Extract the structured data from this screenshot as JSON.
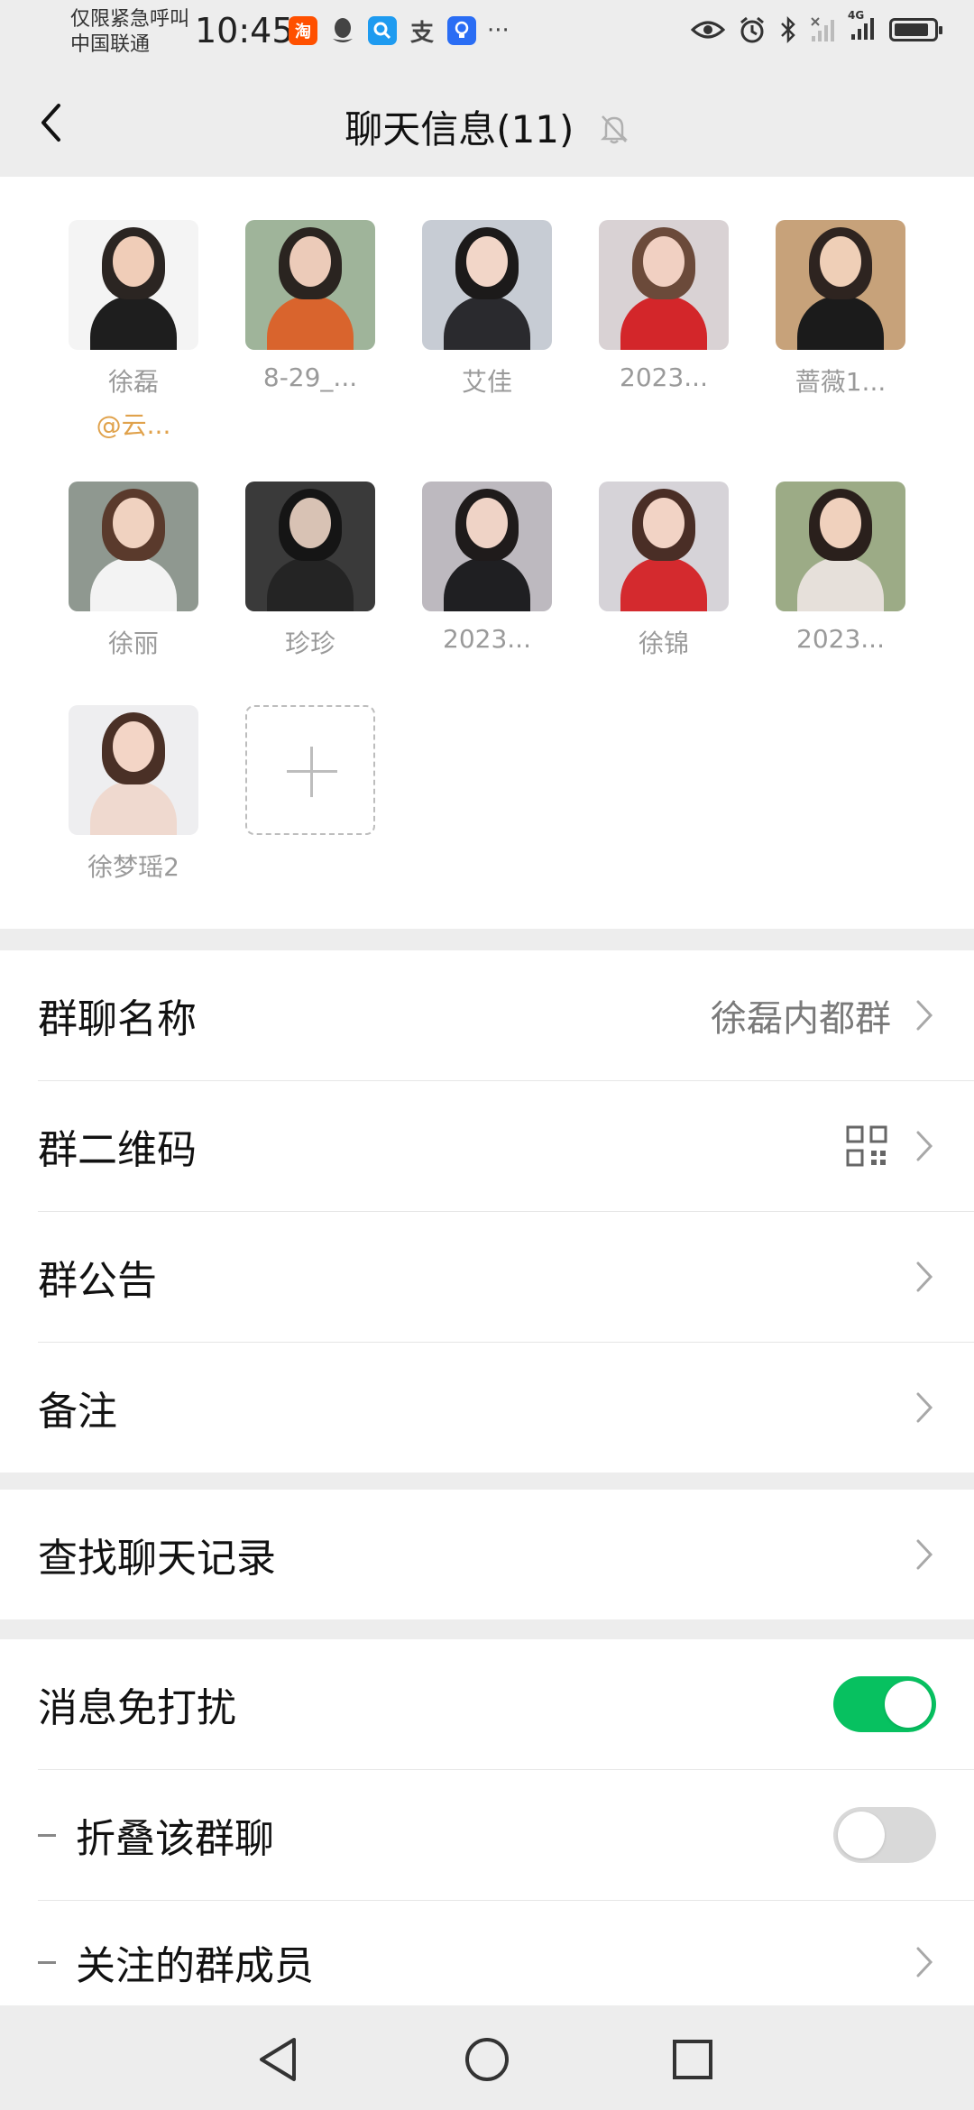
{
  "status_bar": {
    "carrier_line1": "仅限紧急呼叫",
    "carrier_line2": "中国联通",
    "time": "10:45",
    "app_icons": [
      {
        "name": "taobao-icon",
        "glyph": "淘",
        "color": "#ff5000"
      },
      {
        "name": "qq-icon",
        "glyph": "♟",
        "color": "#444444"
      },
      {
        "name": "search-app-icon",
        "glyph": "Q",
        "color": "#1e9bf0"
      },
      {
        "name": "alipay-icon",
        "glyph": "支",
        "color": "#444444"
      },
      {
        "name": "bulb-app-icon",
        "glyph": "◉",
        "color": "#2a6df4"
      }
    ],
    "more": "···",
    "network_label": "4G"
  },
  "header": {
    "title": "聊天信息(11)"
  },
  "members": [
    {
      "name": "徐磊",
      "tag": "@云...",
      "bg": "#f4f4f4",
      "hair": "#2b2522",
      "skin": "#f0cdb8",
      "body": "#1e1e1e"
    },
    {
      "name": "8-29_...",
      "bg": "#9fb49a",
      "hair": "#2a2420",
      "skin": "#eccbb9",
      "body": "#d9642d"
    },
    {
      "name": "艾佳",
      "bg": "#c7ccd4",
      "hair": "#1c1a1a",
      "skin": "#f2d6c8",
      "body": "#2a2a2e"
    },
    {
      "name": "2023...",
      "bg": "#d9d2d4",
      "hair": "#6b4a3a",
      "skin": "#f1d0c2",
      "body": "#d3262a"
    },
    {
      "name": "蔷薇1...",
      "bg": "#c7a27a",
      "hair": "#2e2420",
      "skin": "#efcfb7",
      "body": "#1b1b1b"
    },
    {
      "name": "徐丽",
      "bg": "#8f9890",
      "hair": "#5a3a2c",
      "skin": "#f0d2c0",
      "body": "#f3f3f3"
    },
    {
      "name": "珍珍",
      "bg": "#3a3a3a",
      "hair": "#151515",
      "skin": "#d8c2b4",
      "body": "#242424"
    },
    {
      "name": "2023...",
      "bg": "#bdb9bf",
      "hair": "#1f1b1b",
      "skin": "#efd3c6",
      "body": "#1f1f22"
    },
    {
      "name": "徐锦",
      "bg": "#d6d3d8",
      "hair": "#4a2e26",
      "skin": "#f2d3c5",
      "body": "#d42a2e"
    },
    {
      "name": "2023...",
      "bg": "#9cab86",
      "hair": "#2a201c",
      "skin": "#f0d1bd",
      "body": "#e6e0da"
    },
    {
      "name": "徐梦瑶2",
      "bg": "#eeeef0",
      "hair": "#4a3026",
      "skin": "#f3d5c6",
      "body": "#efd9cf"
    }
  ],
  "settings": {
    "group1": {
      "group_name_label": "群聊名称",
      "group_name_value": "徐磊内都群",
      "qr_label": "群二维码",
      "announcement_label": "群公告",
      "remark_label": "备注"
    },
    "group2": {
      "search_history_label": "查找聊天记录"
    },
    "group3": {
      "mute_label": "消息免打扰",
      "mute_on": true,
      "fold_label": "折叠该群聊",
      "fold_on": false,
      "starred_members_label": "关注的群成员"
    }
  },
  "colors": {
    "toggle_on": "#07c160",
    "toggle_off": "#d9d9d9",
    "mention": "#e0a24c"
  }
}
